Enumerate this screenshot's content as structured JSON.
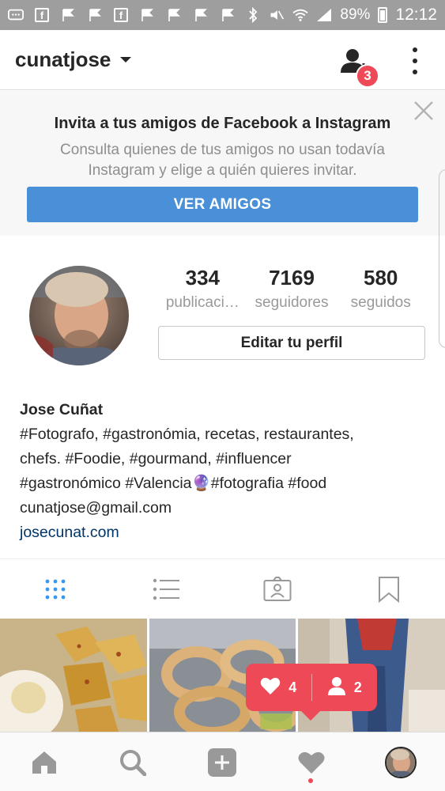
{
  "status": {
    "battery": "89%",
    "time": "12:12",
    "icons": [
      "chat-icon",
      "facebook-icon",
      "flag-icon",
      "flag-icon",
      "facebook-icon",
      "flag-icon",
      "flag-icon",
      "flag-icon",
      "flag-icon",
      "bluetooth-icon",
      "mute-icon",
      "wifi-icon",
      "signal-icon",
      "battery-icon"
    ]
  },
  "header": {
    "username": "cunatjose",
    "notification_badge": "3"
  },
  "invite": {
    "title": "Invita a tus amigos de Facebook a Instagram",
    "text": "Consulta quienes de tus amigos no usan todavía Instagram y elige a quién quieres invitar.",
    "button": "VER AMIGOS"
  },
  "profile": {
    "stats": [
      {
        "value": "334",
        "label": "publicaci…"
      },
      {
        "value": "7169",
        "label": "seguidores"
      },
      {
        "value": "580",
        "label": "seguidos"
      }
    ],
    "edit_button": "Editar tu perfil",
    "name": "Jose Cuñat",
    "bio_lines": [
      "#Fotografo, #gastronómia, recetas, restaurantes,",
      "chefs. #Foodie, #gourmand, #influencer",
      "#gastronómico #Valencia🔮#fotografia #food",
      "cunatjose@gmail.com"
    ],
    "website": "josecunat.com"
  },
  "tabs": [
    "grid-view",
    "list-view",
    "tagged",
    "saved"
  ],
  "activity_popup": {
    "likes": "4",
    "follows": "2"
  },
  "colors": {
    "accent_blue": "#4a90d9",
    "badge_red": "#ed4956",
    "link": "#003569"
  }
}
